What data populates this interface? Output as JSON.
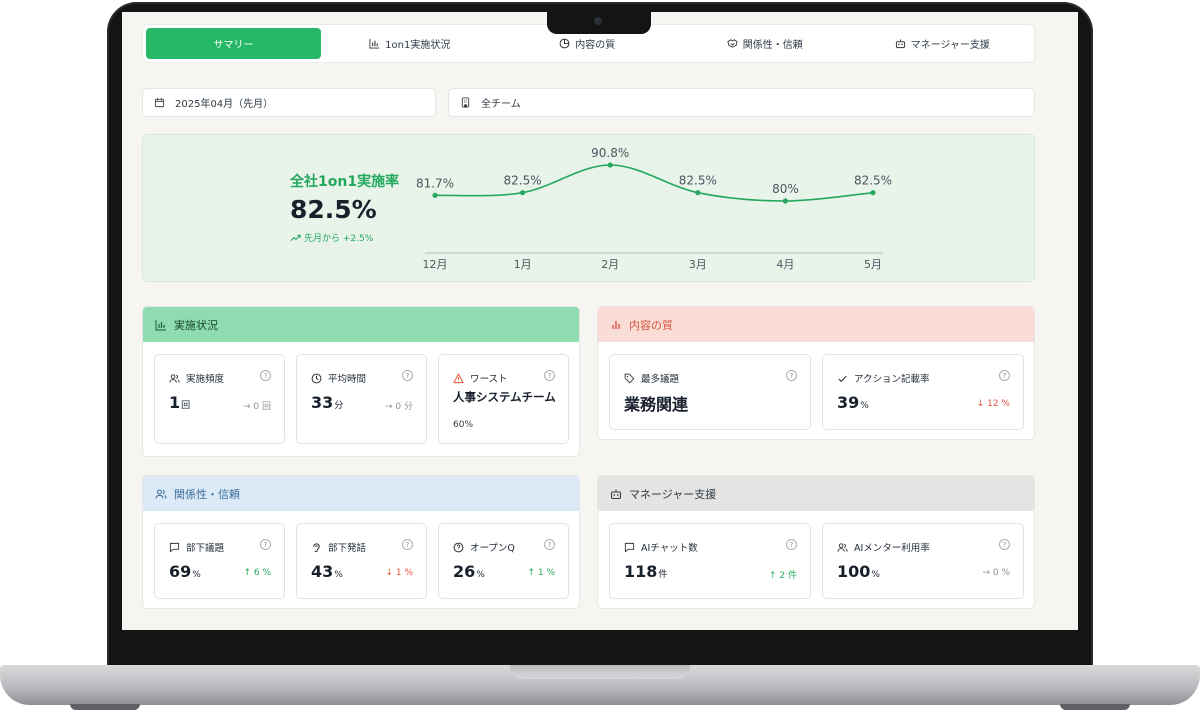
{
  "tabs": [
    {
      "label": "サマリー",
      "icon": "none"
    },
    {
      "label": "1on1実施状況",
      "icon": "bar-chart-icon"
    },
    {
      "label": "内容の質",
      "icon": "pie-chart-icon"
    },
    {
      "label": "関係性・信頼",
      "icon": "handshake-icon"
    },
    {
      "label": "マネージャー支援",
      "icon": "bot-icon"
    }
  ],
  "filters": {
    "period": "2025年04月（先月）",
    "team": "全チーム"
  },
  "rate": {
    "title": "全社1on1実施率",
    "value": "82.5%",
    "delta": "先月から +2.5%"
  },
  "chart_data": {
    "type": "line",
    "categories": [
      "12月",
      "1月",
      "2月",
      "3月",
      "4月",
      "5月"
    ],
    "series": [
      {
        "values": [
          81.7,
          82.5,
          90.8,
          82.5,
          80,
          82.5
        ]
      }
    ],
    "data_labels": [
      "81.7%",
      "82.5%",
      "90.8%",
      "82.5%",
      "80%",
      "82.5%"
    ],
    "color": "#24a85e"
  },
  "sections": {
    "implementation": {
      "title": "実施状況",
      "color": "#8fdcb0",
      "cards": [
        {
          "label": "実施頻度",
          "value": "1",
          "unit": "回",
          "trend": "→ 0 回"
        },
        {
          "label": "平均時間",
          "value": "33",
          "unit": "分",
          "trend": "→ 0 分"
        },
        {
          "label": "ワースト",
          "value": "人事システムチーム",
          "sub": "60%"
        }
      ]
    },
    "quality": {
      "title": "内容の質",
      "color": "#f9ddd6",
      "cards": [
        {
          "label": "最多議題",
          "value": "業務関連"
        },
        {
          "label": "アクション記載率",
          "value": "39",
          "unit": "%",
          "trend": "↓ 12 %"
        }
      ]
    },
    "relationship": {
      "title": "関係性・信頼",
      "color": "#dce9f6",
      "cards": [
        {
          "label": "部下議題",
          "value": "69",
          "unit": "%",
          "trend": "↑ 6 %"
        },
        {
          "label": "部下発話",
          "value": "43",
          "unit": "%",
          "trend": "↓ 1 %"
        },
        {
          "label": "オープンQ",
          "value": "26",
          "unit": "%",
          "trend": "↑ 1 %"
        }
      ]
    },
    "manager": {
      "title": "マネージャー支援",
      "color": "#e5e4e2",
      "cards": [
        {
          "label": "AIチャット数",
          "value": "118",
          "unit": "件",
          "trend": "↑ 2 件"
        },
        {
          "label": "AIメンター利用率",
          "value": "100",
          "unit": "%",
          "trend": "→ 0 %"
        }
      ]
    }
  },
  "help_glyph": "?"
}
